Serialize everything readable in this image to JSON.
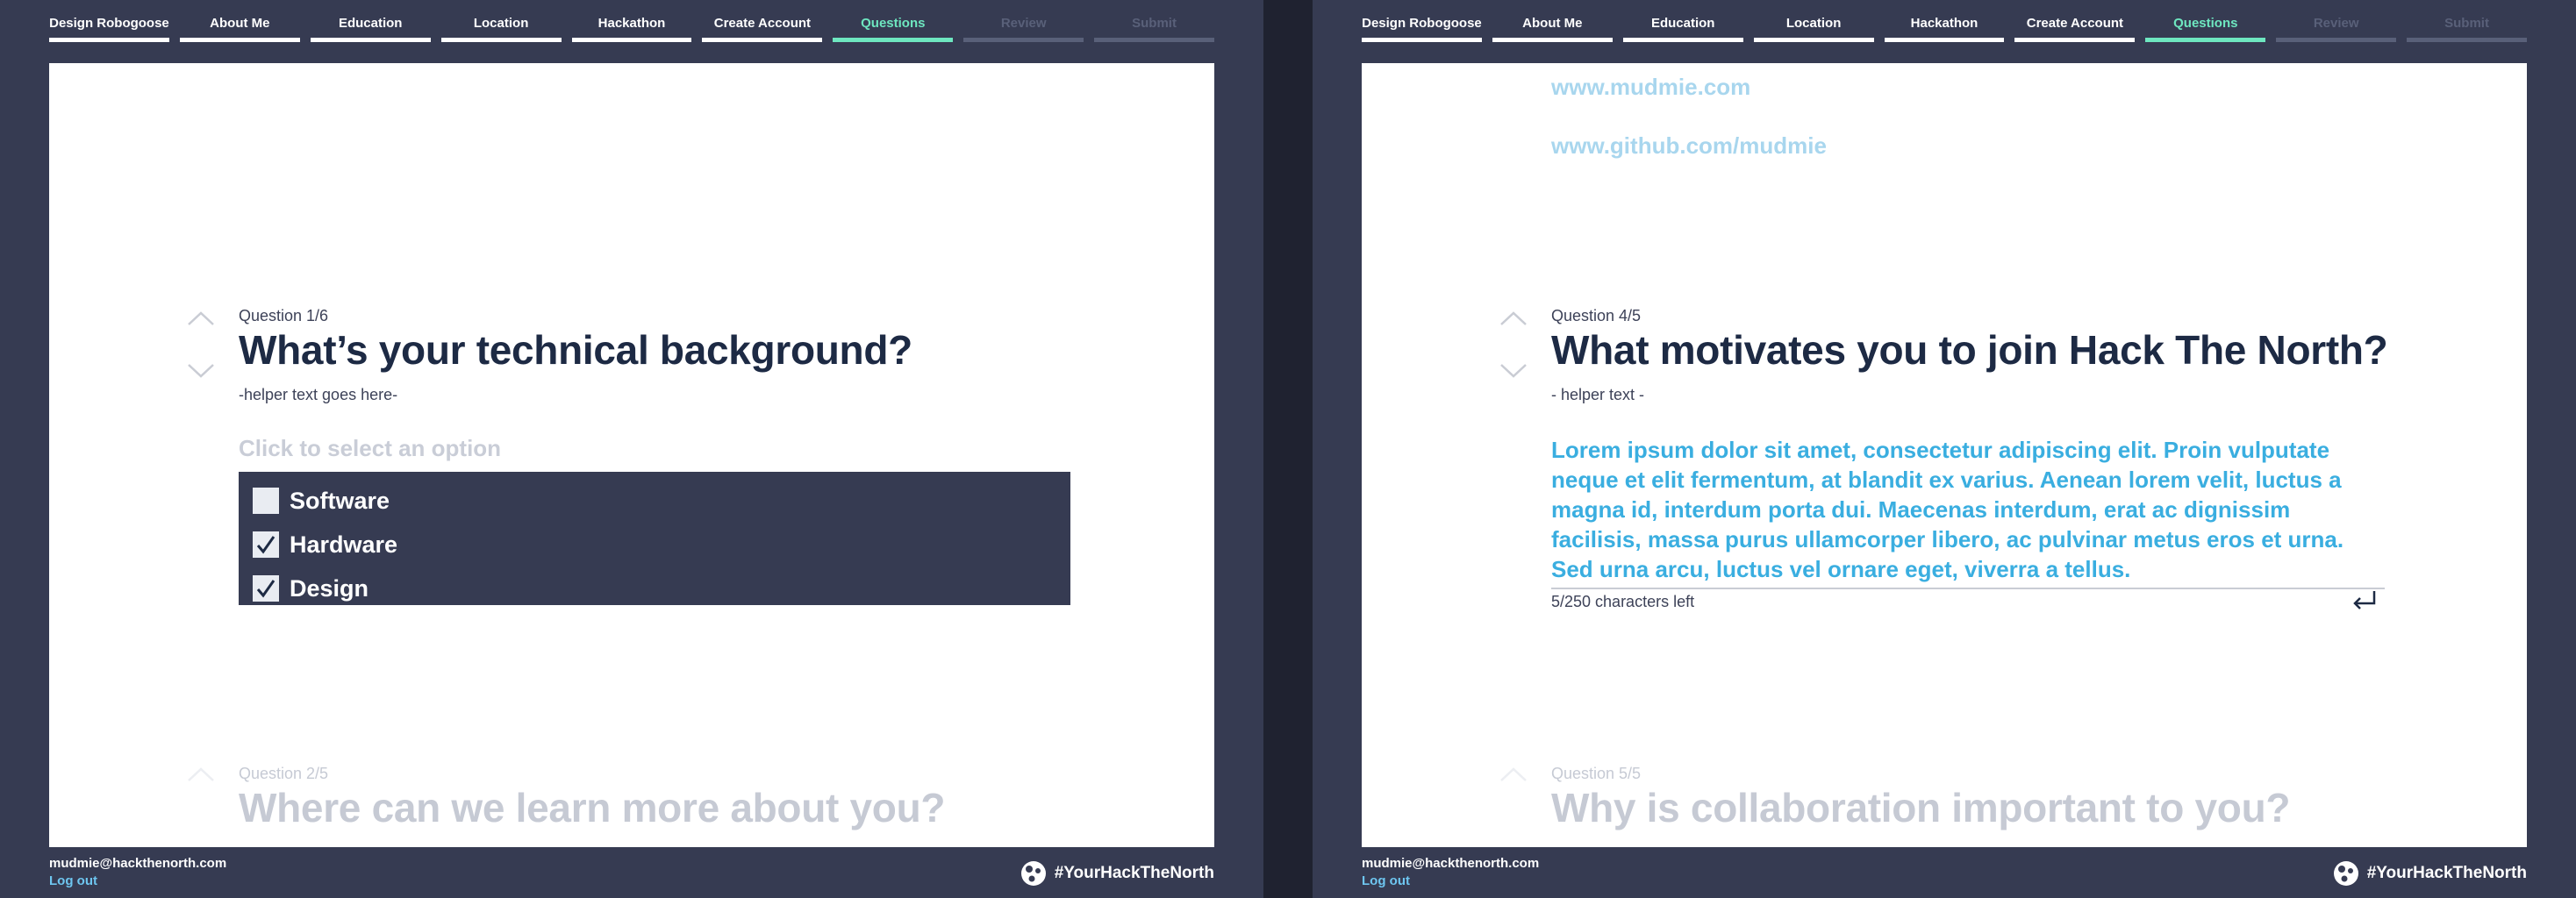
{
  "nav": [
    {
      "label": "Design Robogoose",
      "state": "normal"
    },
    {
      "label": "About Me",
      "state": "normal"
    },
    {
      "label": "Education",
      "state": "normal"
    },
    {
      "label": "Location",
      "state": "normal"
    },
    {
      "label": "Hackathon",
      "state": "normal"
    },
    {
      "label": "Create Account",
      "state": "normal"
    },
    {
      "label": "Questions",
      "state": "active"
    },
    {
      "label": "Review",
      "state": "disabled"
    },
    {
      "label": "Submit",
      "state": "disabled"
    }
  ],
  "left": {
    "current": {
      "label": "Question 1/6",
      "title": "What’s your technical background?",
      "helper": "-helper text goes here-"
    },
    "select": {
      "placeholder": "Click to select an option",
      "options": [
        {
          "label": "Software",
          "checked": false
        },
        {
          "label": "Hardware",
          "checked": true
        },
        {
          "label": "Design",
          "checked": true
        }
      ]
    },
    "next": {
      "label": "Question 2/5",
      "title": "Where can we learn more about you?"
    }
  },
  "right": {
    "previous_answers": [
      "www.mudmie.com",
      "www.github.com/mudmie"
    ],
    "current": {
      "label": "Question 4/5",
      "title": "What motivates you to join Hack The North?",
      "helper": "- helper text -"
    },
    "answer": "Lorem ipsum dolor sit amet, consectetur adipiscing elit. Proin vulputate neque et elit fermentum, at blandit ex varius. Aenean lorem velit, luctus a magna id, interdum porta dui. Maecenas interdum, erat ac dignissim facilisis, massa purus ullamcorper libero, ac pulvinar metus eros et urna. Sed urna arcu, luctus vel ornare eget, viverra a tellus.",
    "char_count": "5/250 characters left",
    "next": {
      "label": "Question 5/5",
      "title": "Why is collaboration important to you?"
    }
  },
  "footer": {
    "email": "mudmie@hackthenorth.com",
    "logout": "Log out",
    "hashtag": "#YourHackTheNorth"
  },
  "colors": {
    "frame": "#363b52",
    "active": "#6ee7c0",
    "accent_text": "#3aaee0",
    "heading": "#1d2a44"
  }
}
